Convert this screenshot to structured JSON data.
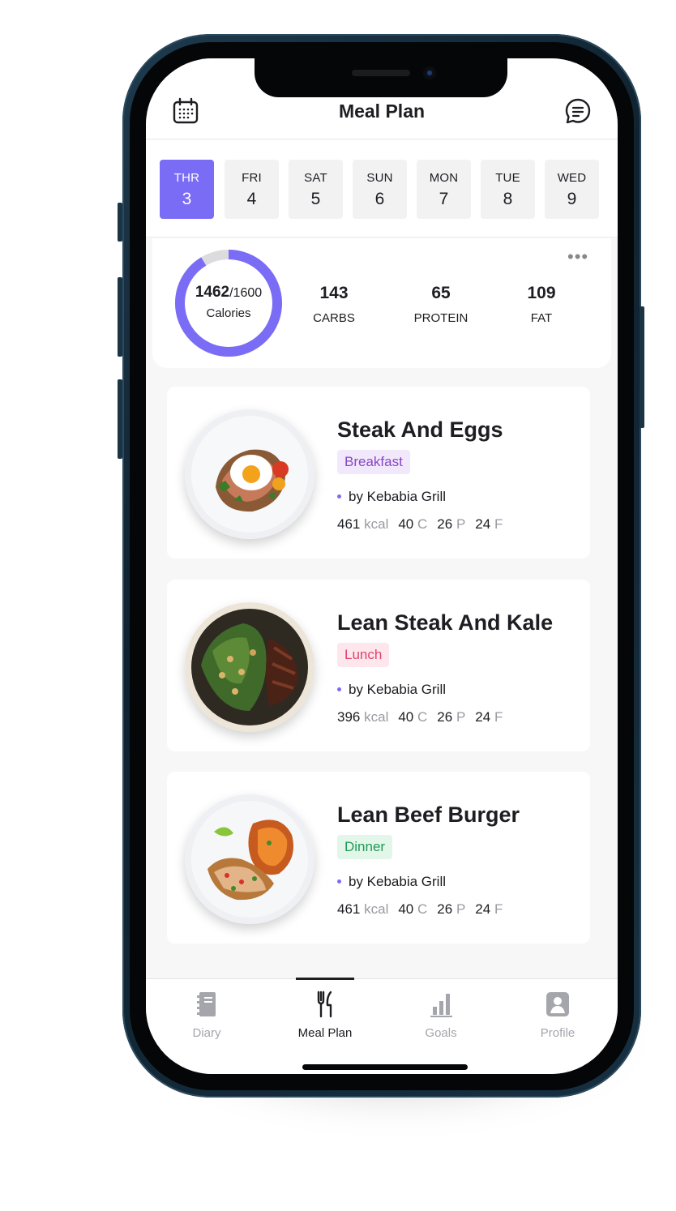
{
  "header": {
    "title": "Meal Plan",
    "left_icon": "calendar-icon",
    "right_icon": "chat-icon"
  },
  "days": [
    {
      "name": "THR",
      "date": "3",
      "active": true
    },
    {
      "name": "FRI",
      "date": "4"
    },
    {
      "name": "SAT",
      "date": "5"
    },
    {
      "name": "SUN",
      "date": "6"
    },
    {
      "name": "MON",
      "date": "7"
    },
    {
      "name": "TUE",
      "date": "8"
    },
    {
      "name": "WED",
      "date": "9"
    }
  ],
  "summary": {
    "calories": "1462",
    "calories_goal": "/1600",
    "calories_label": "Calories",
    "calories_fraction": 0.914,
    "ring_color": "#7b6cf6",
    "macros": [
      {
        "value": "143",
        "label": "CARBS"
      },
      {
        "value": "65",
        "label": "PROTEIN"
      },
      {
        "value": "109",
        "label": "FAT"
      }
    ]
  },
  "meals": [
    {
      "title": "Steak And Eggs",
      "tag": "Breakfast",
      "by": "by Kebabia Grill",
      "kcal": "461",
      "kcal_unit": "kcal",
      "c": "40",
      "c_unit": "C",
      "p": "26",
      "p_unit": "P",
      "f": "24",
      "f_unit": "F"
    },
    {
      "title": "Lean Steak And Kale",
      "tag": "Lunch",
      "by": "by Kebabia Grill",
      "kcal": "396",
      "kcal_unit": "kcal",
      "c": "40",
      "c_unit": "C",
      "p": "26",
      "p_unit": "P",
      "f": "24",
      "f_unit": "F"
    },
    {
      "title": "Lean Beef Burger",
      "tag": "Dinner",
      "by": "by Kebabia Grill",
      "kcal": "461",
      "kcal_unit": "kcal",
      "c": "40",
      "c_unit": "C",
      "p": "26",
      "p_unit": "P",
      "f": "24",
      "f_unit": "F"
    }
  ],
  "tabs": [
    {
      "label": "Diary",
      "icon": "notebook-icon"
    },
    {
      "label": "Meal Plan",
      "icon": "fork-knife-icon",
      "active": true
    },
    {
      "label": "Goals",
      "icon": "bar-chart-icon"
    },
    {
      "label": "Profile",
      "icon": "profile-icon"
    }
  ],
  "colors": {
    "accent": "#7b6cf6",
    "breakfast": "#8a45c8",
    "lunch": "#e0436f",
    "dinner": "#1f9a55"
  }
}
